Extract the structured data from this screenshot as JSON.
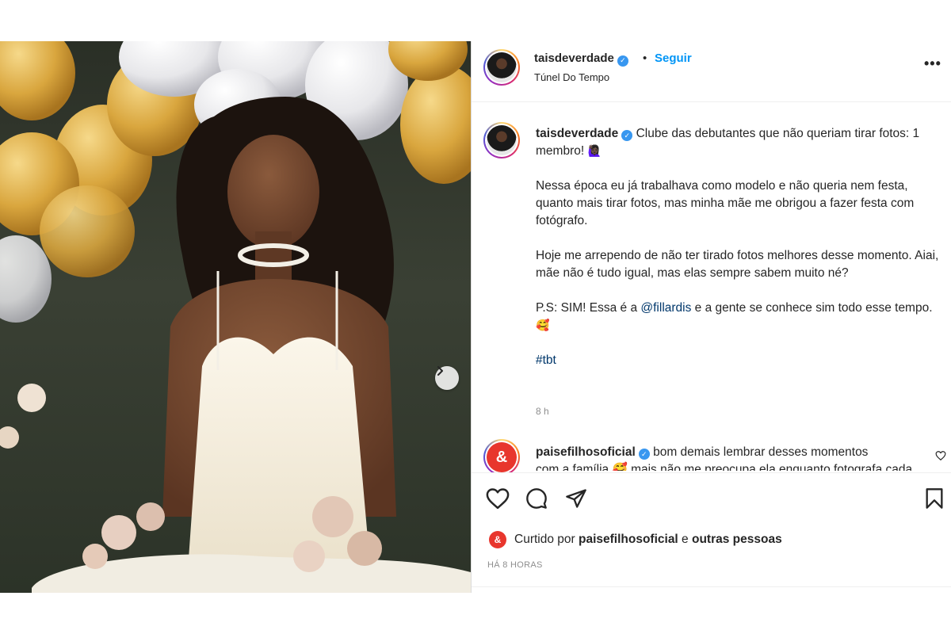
{
  "post": {
    "photo_alt": "Debutante photo",
    "next_label": "›"
  },
  "header": {
    "username": "taisdeverdade",
    "verified_glyph": "✓",
    "separator": "•",
    "follow_label": "Seguir",
    "location": "Túnel Do Tempo",
    "more_label": "•••"
  },
  "caption": {
    "username": "taisdeverdade",
    "line1": "Clube das debutantes que não queriam tirar fotos: 1 membro!",
    "line1_emoji": "🙋🏿‍♀️",
    "para2": "Nessa época eu já trabalhava como modelo e não queria nem festa, quanto mais tirar fotos, mas minha mãe me obrigou a fazer festa com fotógrafo.",
    "para3": "Hoje me arrependo de não ter tirado fotos melhores desse momento. Aiai, mãe não é tudo igual, mas elas sempre sabem muito né?",
    "para4_before": "P.S: SIM! Essa é a ",
    "para4_mention": "@fillardis",
    "para4_after": " e a gente se conhece sim todo esse tempo.",
    "para4_emoji": "🥰",
    "hashtag": "#tbt",
    "time": "8 h"
  },
  "comment": {
    "avatar_glyph": "&",
    "username": "paisefilhosoficial",
    "text": "bom demais lembrar desses momentos",
    "text_line2": "com a família 🥰 mais não me preocupa ela enquanto fotografa cada 😂"
  },
  "likes": {
    "avatar_glyph": "&",
    "prefix": "Curtido por ",
    "user": "paisefilhosoficial",
    "middle": " e ",
    "others": "outras pessoas",
    "posted": "HÁ 8 HORAS"
  },
  "colors": {
    "follow": "#0095f6",
    "verified": "#3897f0",
    "link": "#00376b",
    "brand_red": "#e8362d"
  }
}
